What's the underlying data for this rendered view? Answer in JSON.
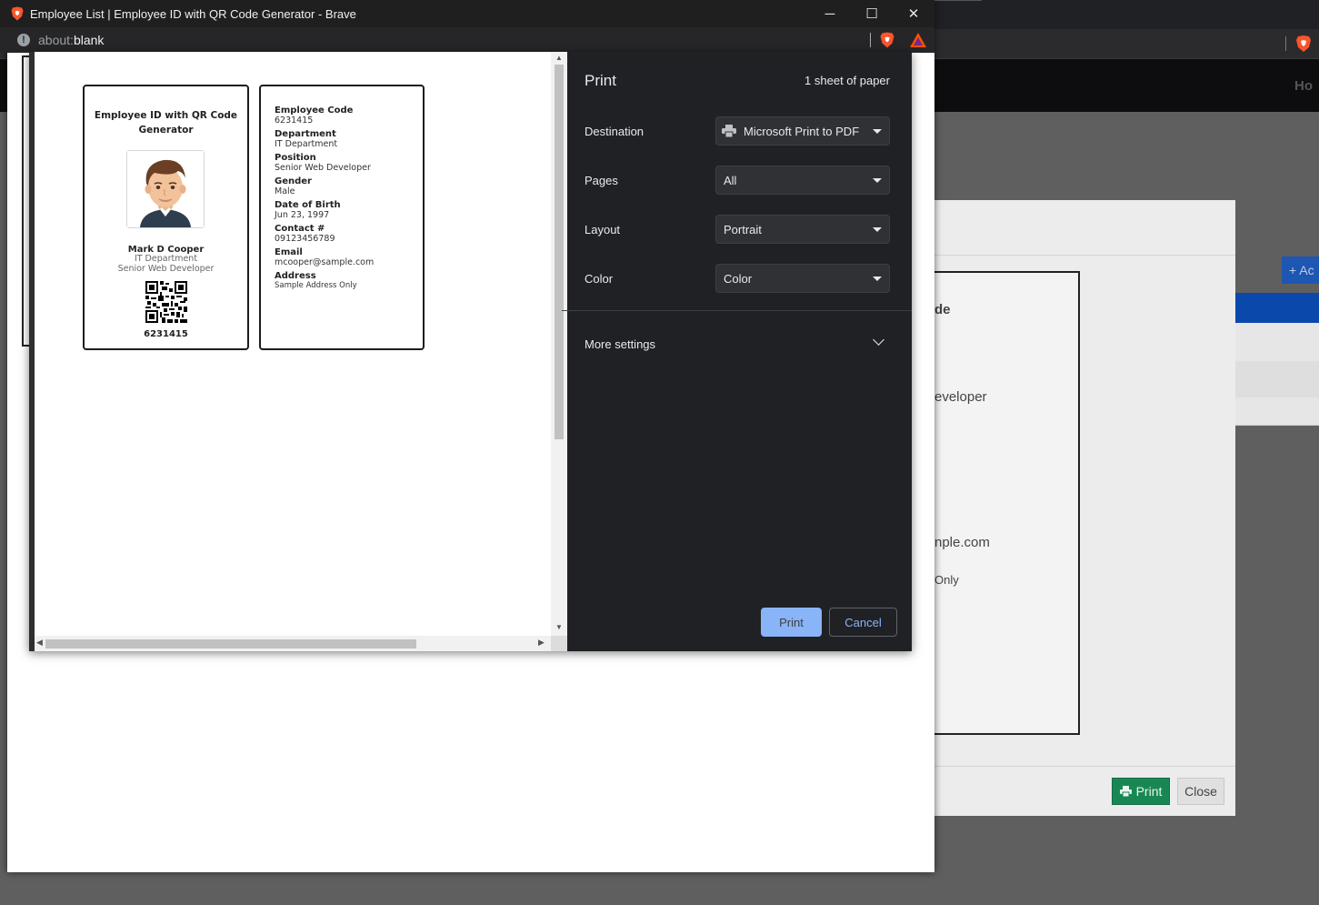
{
  "popup": {
    "window_title": "Employee List | Employee ID with QR Code Generator - Brave",
    "window_controls": {
      "minimize": "─",
      "maximize": "☐",
      "close": "✕"
    },
    "address": {
      "scheme": "about:",
      "path": "blank"
    }
  },
  "print": {
    "title": "Print",
    "sheets": "1 sheet of paper",
    "destination": {
      "label": "Destination",
      "value": "Microsoft Print to PDF"
    },
    "pages": {
      "label": "Pages",
      "value": "All"
    },
    "layout": {
      "label": "Layout",
      "value": "Portrait"
    },
    "color": {
      "label": "Color",
      "value": "Color"
    },
    "more_settings": "More settings",
    "print_button": "Print",
    "cancel_button": "Cancel"
  },
  "id_front": {
    "company": "Employee ID with QR Code Generator",
    "name": "Mark D Cooper",
    "department": "IT Department",
    "position": "Senior Web Developer",
    "code": "6231415"
  },
  "id_back": {
    "fields": [
      {
        "label": "Employee Code",
        "value": "6231415"
      },
      {
        "label": "Department",
        "value": "IT Department"
      },
      {
        "label": "Position",
        "value": "Senior Web Developer"
      },
      {
        "label": "Gender",
        "value": "Male"
      },
      {
        "label": "Date of Birth",
        "value": "Jun 23, 1997"
      },
      {
        "label": "Contact #",
        "value": "09123456789"
      },
      {
        "label": "Email",
        "value": "mcooper@sample.com"
      },
      {
        "label": "Address",
        "value": "Sample Address Only"
      }
    ]
  },
  "background": {
    "nav_text": "Ho",
    "add_button": "+ Ac",
    "card_fragments": [
      "de",
      "eveloper",
      "nple.com",
      "Only"
    ],
    "print_button": "Print",
    "close_button": "Close"
  },
  "colors": {
    "dialog_bg": "#202124",
    "accent": "#8ab4f8",
    "bg_print_button": "#198754",
    "bg_table_header": "#0a48ac"
  }
}
